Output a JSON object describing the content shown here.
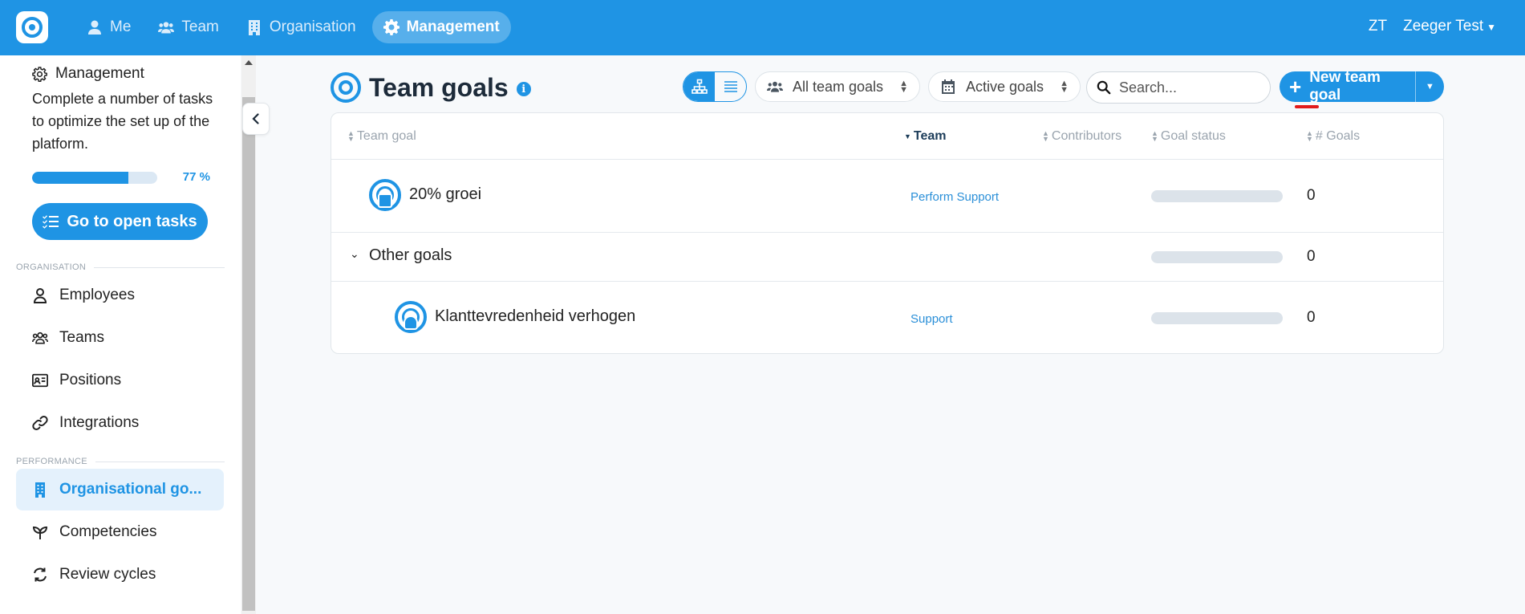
{
  "topbar": {
    "nav": [
      {
        "label": "Me",
        "icon": "user-icon"
      },
      {
        "label": "Team",
        "icon": "users-icon"
      },
      {
        "label": "Organisation",
        "icon": "building-icon"
      },
      {
        "label": "Management",
        "icon": "gear-icon",
        "active": true
      }
    ],
    "user_initials": "ZT",
    "user_name": "Zeeger Test"
  },
  "sidebar": {
    "management_label": "Management",
    "description": "Complete a number of tasks to optimize the set up of the platform.",
    "progress_percent": 77,
    "progress_label": "77 %",
    "open_tasks_label": "Go to open tasks",
    "sections": [
      {
        "label": "ORGANISATION"
      },
      {
        "label": "PERFORMANCE"
      }
    ],
    "items": [
      {
        "label": "Employees"
      },
      {
        "label": "Teams"
      },
      {
        "label": "Positions"
      },
      {
        "label": "Integrations"
      },
      {
        "label": "Organisational go...",
        "active": true
      },
      {
        "label": "Competencies"
      },
      {
        "label": "Review cycles"
      }
    ]
  },
  "main": {
    "title": "Team goals",
    "info_glyph": "i",
    "filters": {
      "team_filter": "All team goals",
      "status_filter": "Active goals"
    },
    "search": {
      "placeholder": "Search...",
      "value": ""
    },
    "new_button": "New team goal",
    "table": {
      "headers": [
        "Team goal",
        "Team",
        "Contributors",
        "Goal status",
        "# Goals"
      ],
      "sorted_column": "Team",
      "rows": [
        {
          "goal": "20% groei",
          "team": "Perform Support",
          "goals": "0",
          "progress": 0
        },
        {
          "group": "Other goals",
          "goals": "0",
          "progress": 0
        },
        {
          "goal": "Klanttevredenheid verhogen",
          "team": "Support",
          "goals": "0",
          "progress": 0
        }
      ]
    }
  },
  "colors": {
    "accent": "#1f94e4",
    "topbar": "#1f94e4",
    "active_bg": "#e4f1fc"
  }
}
